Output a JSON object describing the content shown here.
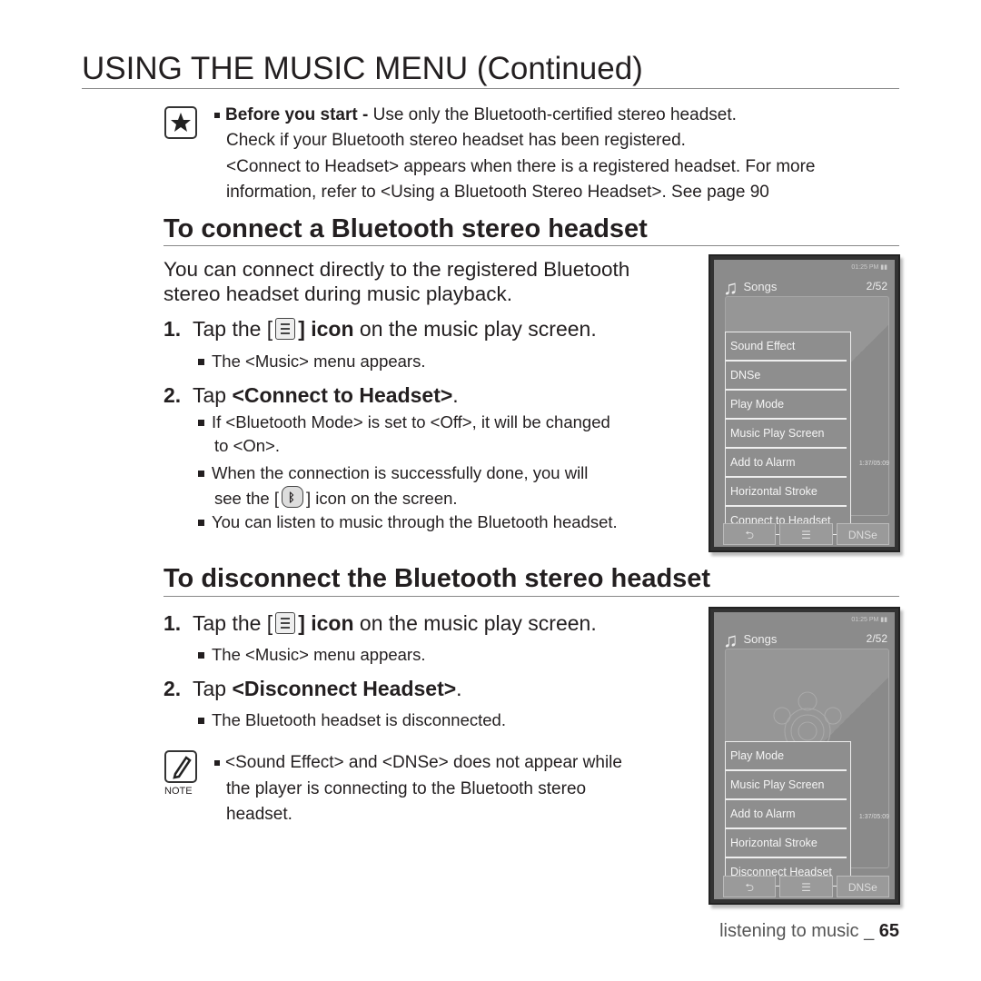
{
  "title": "USING THE MUSIC MENU (Continued)",
  "note_top": {
    "bold": "Before you start - ",
    "line1": "Use only the Bluetooth-certified stereo headset.",
    "line2": "Check if your Bluetooth stereo headset has been registered.",
    "line3": "<Connect to Headset> appears when there is a registered headset. For more",
    "line4": "information, refer to <Using a Bluetooth Stereo Headset>. See page 90"
  },
  "connect": {
    "heading": "To connect a Bluetooth stereo headset",
    "intro1": "You can connect directly to the registered Bluetooth",
    "intro2": "stereo headset during music playback.",
    "step1_num": "1.",
    "step1_pre": "Tap the [",
    "step1_post": "] icon",
    "step1_rest": " on the music play screen.",
    "step1_bullet": "The <Music> menu appears.",
    "step2_num": "2.",
    "step2_pre": "Tap ",
    "step2_bold": "<Connect to Headset>",
    "step2_post": ".",
    "bullet_a1": "If <Bluetooth Mode> is set to <Off>, it will be changed",
    "bullet_a2": "to <On>.",
    "bullet_b1": "When the connection is successfully done, you will",
    "bullet_b2_pre": "see the [",
    "bullet_b2_post": "] icon on the screen.",
    "bullet_c": "You can listen to music through the Bluetooth headset."
  },
  "disconnect": {
    "heading": "To disconnect the Bluetooth stereo headset",
    "step1_num": "1.",
    "step1_pre": "Tap the [",
    "step1_post": "] icon",
    "step1_rest": " on the music play screen.",
    "step1_bullet": "The <Music> menu appears.",
    "step2_num": "2.",
    "step2_pre": "Tap ",
    "step2_bold": "<Disconnect Headset>",
    "step2_post": ".",
    "step2_bullet": "The Bluetooth headset is disconnected."
  },
  "note_bottom": {
    "label": "NOTE",
    "line1": "<Sound Effect> and <DNSe> does not appear while",
    "line2": "the player is connecting to the Bluetooth stereo",
    "line3": "headset."
  },
  "device1": {
    "time": "01:25 PM",
    "header": "Songs",
    "count": "2/52",
    "progress": "1:37/05:09",
    "menu": [
      "Sound Effect",
      "DNSe",
      "Play Mode",
      "Music Play Screen",
      "Add to Alarm",
      "Horizontal Stroke",
      "Connect to Headset"
    ],
    "dnse_button": "DNSe"
  },
  "device2": {
    "time": "01:25 PM",
    "header": "Songs",
    "count": "2/52",
    "progress": "1:37/05:09",
    "menu": [
      "Play Mode",
      "Music Play Screen",
      "Add to Alarm",
      "Horizontal Stroke",
      "Disconnect Headset"
    ],
    "dnse_button": "DNSe"
  },
  "footer": {
    "text": "listening to music _ ",
    "page": "65"
  }
}
